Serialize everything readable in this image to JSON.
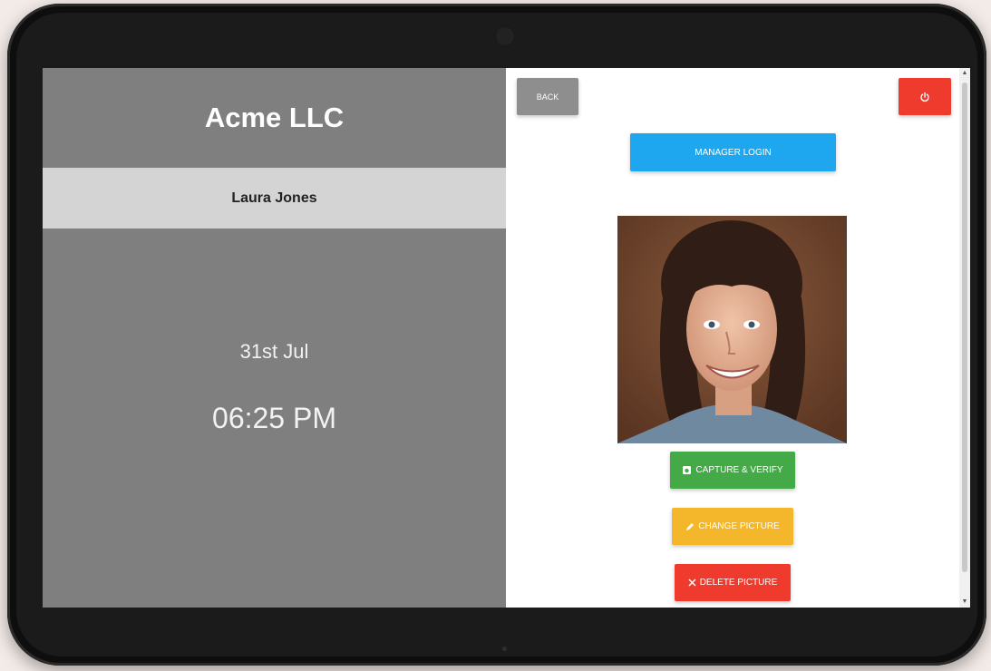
{
  "left_panel": {
    "company_name": "Acme LLC",
    "user_name": "Laura Jones",
    "date": "31st Jul",
    "time": "06:25 PM"
  },
  "right_panel": {
    "back_label": "BACK",
    "power_icon": "power-icon",
    "manager_login_label": "MANAGER LOGIN",
    "capture_label": "CAPTURE & VERIFY",
    "capture_icon": "camera-icon",
    "change_label": "CHANGE PICTURE",
    "change_icon": "pencil-icon",
    "delete_label": "DELETE PICTURE",
    "delete_icon": "x-icon"
  },
  "colors": {
    "left_panel_bg": "#7f7f7f",
    "user_band_bg": "#d4d4d4",
    "back_button": "#8e8e8e",
    "power_button": "#ef3b2d",
    "manager_button": "#1ea6ee",
    "capture_button": "#44a947",
    "change_button": "#f4b62a",
    "delete_button": "#ef3a2e"
  }
}
